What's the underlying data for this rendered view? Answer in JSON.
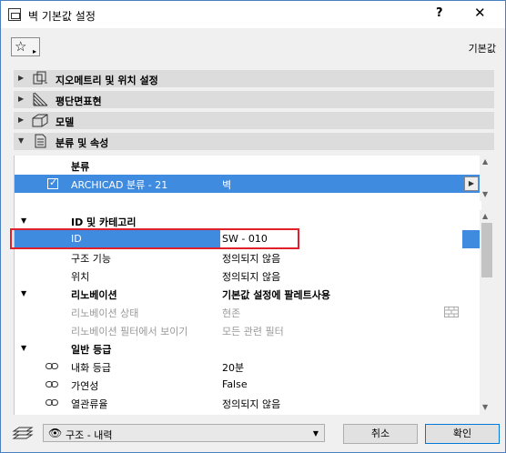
{
  "window": {
    "title": "벽 기본값 설정",
    "help": "?",
    "close": "✕"
  },
  "toolbar": {
    "favorites_glyph": "☆",
    "favorites_arrow": "▸",
    "default_label": "기본값"
  },
  "sections": [
    {
      "label": "지오메트리 및 위치 설정",
      "expanded": false,
      "icon": "geometry-icon"
    },
    {
      "label": "평단면표현",
      "expanded": false,
      "icon": "floorplan-hatch-icon"
    },
    {
      "label": "모델",
      "expanded": false,
      "icon": "model-box-icon"
    },
    {
      "label": "분류 및 속성",
      "expanded": true,
      "icon": "document-list-icon"
    }
  ],
  "classification": {
    "header": "분류",
    "row": {
      "name": "ARCHICAD 분류 - 21",
      "value": "벽",
      "checked": true
    }
  },
  "groups": {
    "id_category": {
      "label": "ID 및 카테고리"
    },
    "renovation": {
      "label": "리노베이션",
      "value": "기본값 설정에 팔레트사용"
    },
    "general": {
      "label": "일반 등급"
    }
  },
  "rows": {
    "id": {
      "label": "ID",
      "value": "SW - 010"
    },
    "structural_function": {
      "label": "구조 기능",
      "value": "정의되지 않음"
    },
    "position": {
      "label": "위치",
      "value": "정의되지 않음"
    },
    "renovation_status": {
      "label": "리노베이션 상태",
      "value": "현존"
    },
    "renovation_filter": {
      "label": "리노베이션 필터에서 보이기",
      "value": "모든 관련 필터"
    },
    "fire_rating": {
      "label": "내화 등급",
      "value": "20분"
    },
    "combustibility": {
      "label": "가연성",
      "value": "False"
    },
    "thermal": {
      "label": "열관류율",
      "value": "정의되지 않음"
    }
  },
  "bottom": {
    "layer_value": "구조 - 내력",
    "cancel_label": "취소",
    "ok_label": "확인"
  },
  "colors": {
    "selection": "#3e8be0",
    "highlight_border": "#e0202a",
    "section_bg": "#dcdcdc"
  }
}
